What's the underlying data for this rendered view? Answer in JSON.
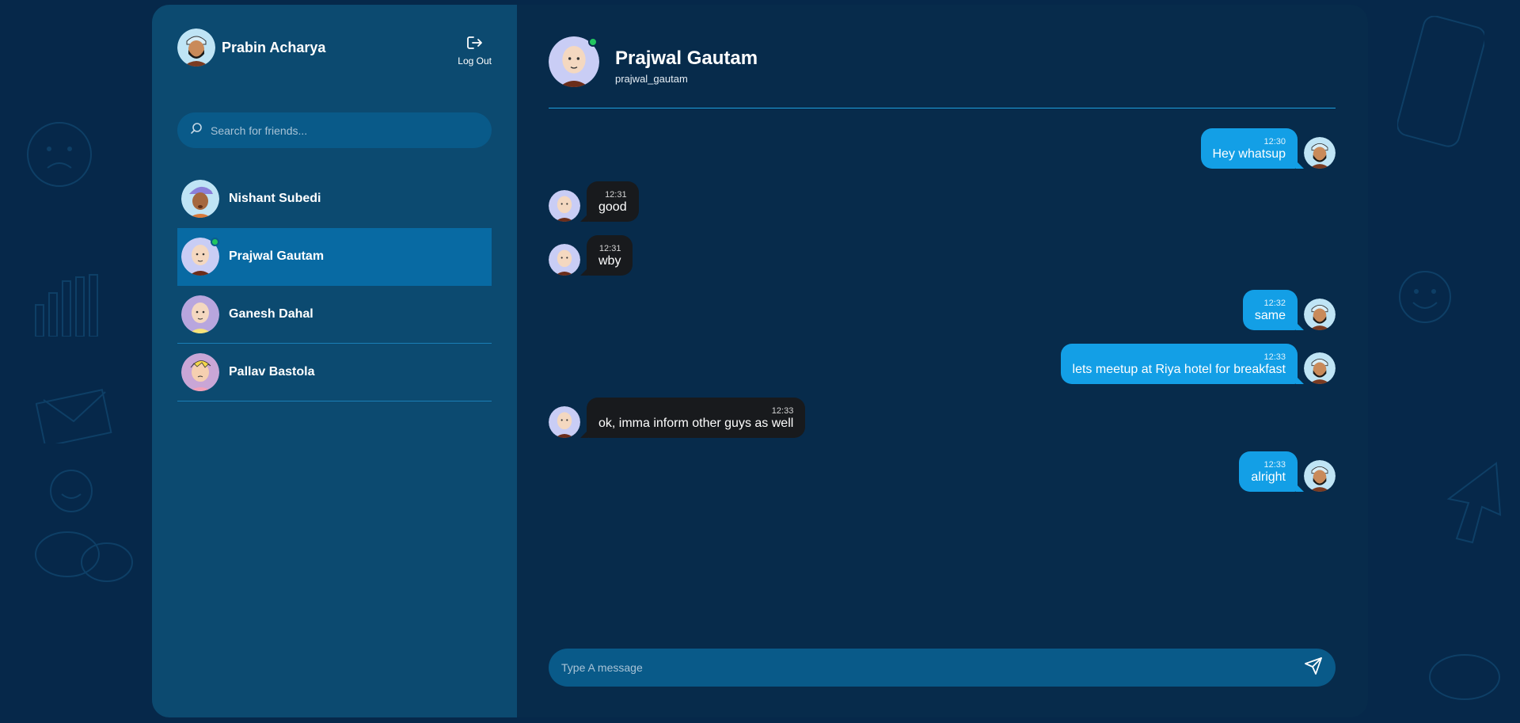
{
  "current_user": {
    "name": "Prabin Acharya",
    "avatar": "bearded-man-avatar"
  },
  "logout": {
    "label": "Log Out",
    "icon": "logout-icon"
  },
  "search": {
    "placeholder": "Search for friends...",
    "icon": "search-icon"
  },
  "friends": [
    {
      "name": "Nishant Subedi",
      "avatar": "purple-cap-avatar",
      "online": false,
      "active": false
    },
    {
      "name": "Prajwal Gautam",
      "avatar": "bald-man-avatar",
      "online": true,
      "active": true
    },
    {
      "name": "Ganesh Dahal",
      "avatar": "bald-man-avatar",
      "online": false,
      "active": false
    },
    {
      "name": "Pallav Bastola",
      "avatar": "blonde-man-avatar",
      "online": false,
      "active": false
    }
  ],
  "chat": {
    "name": "Prajwal Gautam",
    "username": "prajwal_gautam",
    "online": true,
    "messages": [
      {
        "direction": "sent",
        "time": "12:30",
        "text": "Hey whatsup"
      },
      {
        "direction": "recv",
        "time": "12:31",
        "text": "good"
      },
      {
        "direction": "recv",
        "time": "12:31",
        "text": "wby"
      },
      {
        "direction": "sent",
        "time": "12:32",
        "text": "same"
      },
      {
        "direction": "sent",
        "time": "12:33",
        "text": "lets meetup at Riya hotel for breakfast"
      },
      {
        "direction": "recv",
        "time": "12:33",
        "text": "ok, imma inform other guys as well"
      },
      {
        "direction": "sent",
        "time": "12:33",
        "text": "alright"
      }
    ]
  },
  "composer": {
    "placeholder": "Type A message",
    "send_icon": "send-icon"
  },
  "colors": {
    "page_bg": "#06284a",
    "sidebar_bg": "#0c4a70",
    "active_friend": "#086aa3",
    "sent_bubble": "#139fe6",
    "recv_bubble": "#181a1d",
    "online": "#22c55e"
  }
}
